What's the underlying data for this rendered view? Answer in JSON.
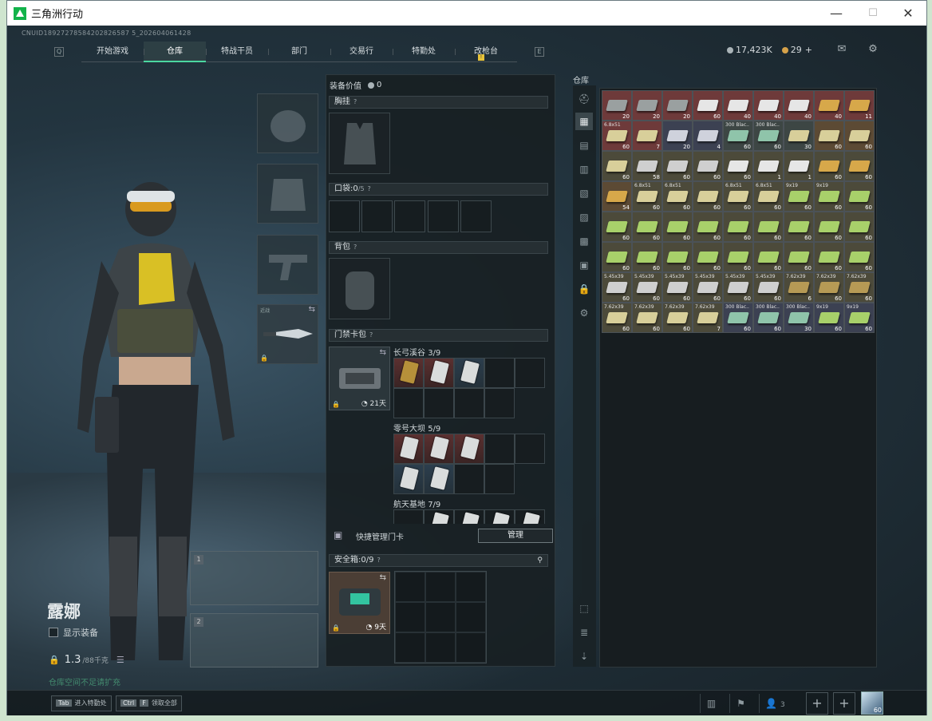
{
  "window": {
    "title": "三角洲行动",
    "minimize": "—",
    "maximize": "☐",
    "close": "✕"
  },
  "uid": "CNUID18927278584202826587 5_202604061428",
  "nav": {
    "key_left": "Q",
    "key_right": "E",
    "badge": "!",
    "tabs": [
      "开始游戏",
      "仓库",
      "特战干员",
      "部门",
      "交易行",
      "特勤处",
      "改枪台"
    ],
    "active": "仓库"
  },
  "currency": {
    "silver": "17,423K",
    "gold": "29",
    "plus": "+"
  },
  "character": {
    "name": "露娜",
    "show_equipment": "显示装备",
    "weight": "1.3",
    "weight_max": "/88千克",
    "hint": "仓库空间不足请扩充"
  },
  "equipment": {
    "weapon_slot_1": "1",
    "weapon_slot_2": "2",
    "melee_label": "近战"
  },
  "loadout": {
    "value_label": "装备价值",
    "value": "0",
    "chest_rig": "胸挂",
    "pocket_label": "口袋:",
    "pocket_value": "0",
    "pocket_max": "/5",
    "backpack": "背包",
    "keycard_bag": "门禁卡包",
    "keycard_days": "21天",
    "maps": [
      {
        "name": "长弓溪谷",
        "count": "3/9"
      },
      {
        "name": "零号大坝",
        "count": "5/9"
      },
      {
        "name": "航天基地",
        "count": "7/9"
      }
    ],
    "quick_manage": "快捷管理门卡",
    "manage_btn": "管理",
    "safebox_label": "安全箱:",
    "safebox_value": "0/9",
    "safebox_days": "9天"
  },
  "warehouse": {
    "label": "仓库",
    "items": [
      {
        "n": "",
        "c": "20",
        "bg": "#6e3a3a",
        "ob": "#9aa0a0"
      },
      {
        "n": "",
        "c": "20",
        "bg": "#6e3a3a",
        "ob": "#9aa0a0"
      },
      {
        "n": "",
        "c": "20",
        "bg": "#6e3a3a",
        "ob": "#9aa0a0"
      },
      {
        "n": "",
        "c": "60",
        "bg": "#6e3a3a",
        "ob": "#e6e6e6"
      },
      {
        "n": "",
        "c": "40",
        "bg": "#6e3a3a",
        "ob": "#e6e6e6"
      },
      {
        "n": "",
        "c": "40",
        "bg": "#6e3a3a",
        "ob": "#e6e6e6"
      },
      {
        "n": "",
        "c": "40",
        "bg": "#6e3a3a",
        "ob": "#e6e6e6"
      },
      {
        "n": "",
        "c": "40",
        "bg": "#6e3a3a",
        "ob": "#d7a84a"
      },
      {
        "n": "",
        "c": "11",
        "bg": "#6e3a3a",
        "ob": "#d7a84a"
      },
      {
        "n": "6.8x51",
        "c": "60",
        "bg": "#6e3a3a",
        "ob": "#d8cf9a"
      },
      {
        "n": "",
        "c": "7",
        "bg": "#6e3a3a",
        "ob": "#d8cf9a"
      },
      {
        "n": "",
        "c": "20",
        "bg": "#3c4152",
        "ob": "#cfd2dc"
      },
      {
        "n": "",
        "c": "4",
        "bg": "#3c4152",
        "ob": "#cfd2dc"
      },
      {
        "n": "300 Blac..",
        "c": "60",
        "bg": "#3d4644",
        "ob": "#8fc4aa"
      },
      {
        "n": "300 Blac..",
        "c": "60",
        "bg": "#3d4644",
        "ob": "#8fc4aa"
      },
      {
        "n": "",
        "c": "30",
        "bg": "#3d4644",
        "ob": "#d8cf9a"
      },
      {
        "n": "",
        "c": "60",
        "bg": "#5c4a34",
        "ob": "#d8cf9a"
      },
      {
        "n": "",
        "c": "60",
        "bg": "#5c4a34",
        "ob": "#d8cf9a"
      },
      {
        "n": "",
        "c": "60",
        "bg": "#4c4a3a",
        "ob": "#d8cf9a"
      },
      {
        "n": "",
        "c": "58",
        "bg": "#4c4a3a",
        "ob": "#cfcfcf"
      },
      {
        "n": "",
        "c": "60",
        "bg": "#4c4a3a",
        "ob": "#cfcfcf"
      },
      {
        "n": "",
        "c": "60",
        "bg": "#4c4a3a",
        "ob": "#cfcfcf"
      },
      {
        "n": "",
        "c": "60",
        "bg": "#4c4a3a",
        "ob": "#e6e6e6"
      },
      {
        "n": "",
        "c": "1",
        "bg": "#4c4a3a",
        "ob": "#e6e6e6"
      },
      {
        "n": "",
        "c": "1",
        "bg": "#4c4a3a",
        "ob": "#e6e6e6"
      },
      {
        "n": "",
        "c": "60",
        "bg": "#4c4a3a",
        "ob": "#d7a84a"
      },
      {
        "n": "",
        "c": "60",
        "bg": "#4c4a3a",
        "ob": "#d7a84a"
      },
      {
        "n": "",
        "c": "54",
        "bg": "#5c4a34",
        "ob": "#d7a84a"
      },
      {
        "n": "6.8x51",
        "c": "60",
        "bg": "#4c4a3a",
        "ob": "#d8cf9a"
      },
      {
        "n": "6.8x51",
        "c": "60",
        "bg": "#4c4a3a",
        "ob": "#d8cf9a"
      },
      {
        "n": "",
        "c": "60",
        "bg": "#4c4a3a",
        "ob": "#d8cf9a"
      },
      {
        "n": "6.8x51",
        "c": "60",
        "bg": "#4c4a3a",
        "ob": "#d8cf9a"
      },
      {
        "n": "6.8x51",
        "c": "60",
        "bg": "#4c4a3a",
        "ob": "#d8cf9a"
      },
      {
        "n": "9x19",
        "c": "60",
        "bg": "#4c4a3a",
        "ob": "#a8d06a"
      },
      {
        "n": "9x19",
        "c": "60",
        "bg": "#4c4a3a",
        "ob": "#a8d06a"
      },
      {
        "n": "",
        "c": "60",
        "bg": "#4c4a3a",
        "ob": "#a8d06a"
      },
      {
        "n": "",
        "c": "60",
        "bg": "#4c4a3a",
        "ob": "#a8d06a"
      },
      {
        "n": "",
        "c": "60",
        "bg": "#4c4a3a",
        "ob": "#a8d06a"
      },
      {
        "n": "",
        "c": "60",
        "bg": "#4c4a3a",
        "ob": "#a8d06a"
      },
      {
        "n": "",
        "c": "60",
        "bg": "#4c4a3a",
        "ob": "#a8d06a"
      },
      {
        "n": "",
        "c": "60",
        "bg": "#4c4a3a",
        "ob": "#a8d06a"
      },
      {
        "n": "",
        "c": "60",
        "bg": "#4c4a3a",
        "ob": "#a8d06a"
      },
      {
        "n": "",
        "c": "60",
        "bg": "#4c4a3a",
        "ob": "#a8d06a"
      },
      {
        "n": "",
        "c": "60",
        "bg": "#4c4a3a",
        "ob": "#a8d06a"
      },
      {
        "n": "",
        "c": "60",
        "bg": "#4c4a3a",
        "ob": "#a8d06a"
      },
      {
        "n": "",
        "c": "60",
        "bg": "#4c4a3a",
        "ob": "#a8d06a"
      },
      {
        "n": "",
        "c": "60",
        "bg": "#4c4a3a",
        "ob": "#a8d06a"
      },
      {
        "n": "",
        "c": "60",
        "bg": "#4c4a3a",
        "ob": "#a8d06a"
      },
      {
        "n": "",
        "c": "60",
        "bg": "#4c4a3a",
        "ob": "#a8d06a"
      },
      {
        "n": "",
        "c": "60",
        "bg": "#4c4a3a",
        "ob": "#a8d06a"
      },
      {
        "n": "",
        "c": "60",
        "bg": "#4c4a3a",
        "ob": "#a8d06a"
      },
      {
        "n": "",
        "c": "60",
        "bg": "#4c4a3a",
        "ob": "#a8d06a"
      },
      {
        "n": "",
        "c": "60",
        "bg": "#4c4a3a",
        "ob": "#a8d06a"
      },
      {
        "n": "",
        "c": "60",
        "bg": "#4c4a3a",
        "ob": "#a8d06a"
      },
      {
        "n": "5.45x39",
        "c": "60",
        "bg": "#4c4a3a",
        "ob": "#cfcfcf"
      },
      {
        "n": "5.45x39",
        "c": "60",
        "bg": "#4c4a3a",
        "ob": "#cfcfcf"
      },
      {
        "n": "5.45x39",
        "c": "60",
        "bg": "#4c4a3a",
        "ob": "#cfcfcf"
      },
      {
        "n": "5.45x39",
        "c": "60",
        "bg": "#4c4a3a",
        "ob": "#cfcfcf"
      },
      {
        "n": "5.45x39",
        "c": "60",
        "bg": "#4c4a3a",
        "ob": "#cfcfcf"
      },
      {
        "n": "5.45x39",
        "c": "60",
        "bg": "#4c4a3a",
        "ob": "#cfcfcf"
      },
      {
        "n": "7.62x39",
        "c": "6",
        "bg": "#4c4a3a",
        "ob": "#b69a55"
      },
      {
        "n": "7.62x39",
        "c": "60",
        "bg": "#4c4a3a",
        "ob": "#b69a55"
      },
      {
        "n": "7.62x39",
        "c": "60",
        "bg": "#4c4a3a",
        "ob": "#b69a55"
      },
      {
        "n": "7.62x39",
        "c": "60",
        "bg": "#4c4a3a",
        "ob": "#d8cf9a"
      },
      {
        "n": "7.62x39",
        "c": "60",
        "bg": "#4c4a3a",
        "ob": "#d8cf9a"
      },
      {
        "n": "7.62x39",
        "c": "60",
        "bg": "#4c4a3a",
        "ob": "#d8cf9a"
      },
      {
        "n": "7.62x39",
        "c": "7",
        "bg": "#4c4a3a",
        "ob": "#d8cf9a"
      },
      {
        "n": "300 Blac..",
        "c": "60",
        "bg": "#3c4152",
        "ob": "#8fc4aa"
      },
      {
        "n": "300 Blac..",
        "c": "60",
        "bg": "#3c4152",
        "ob": "#8fc4aa"
      },
      {
        "n": "300 Blac..",
        "c": "30",
        "bg": "#3c4152",
        "ob": "#8fc4aa"
      },
      {
        "n": "9x19",
        "c": "60",
        "bg": "#3c4152",
        "ob": "#a8d06a"
      },
      {
        "n": "9x19",
        "c": "60",
        "bg": "#3c4152",
        "ob": "#a8d06a"
      }
    ]
  },
  "bottom": {
    "tab_key": "Tab",
    "tab_label": "进入特勤处",
    "ctrl_key": "Ctrl",
    "f_key": "F",
    "ctrl_label": "领取全部",
    "friends": "3",
    "level": "60"
  }
}
